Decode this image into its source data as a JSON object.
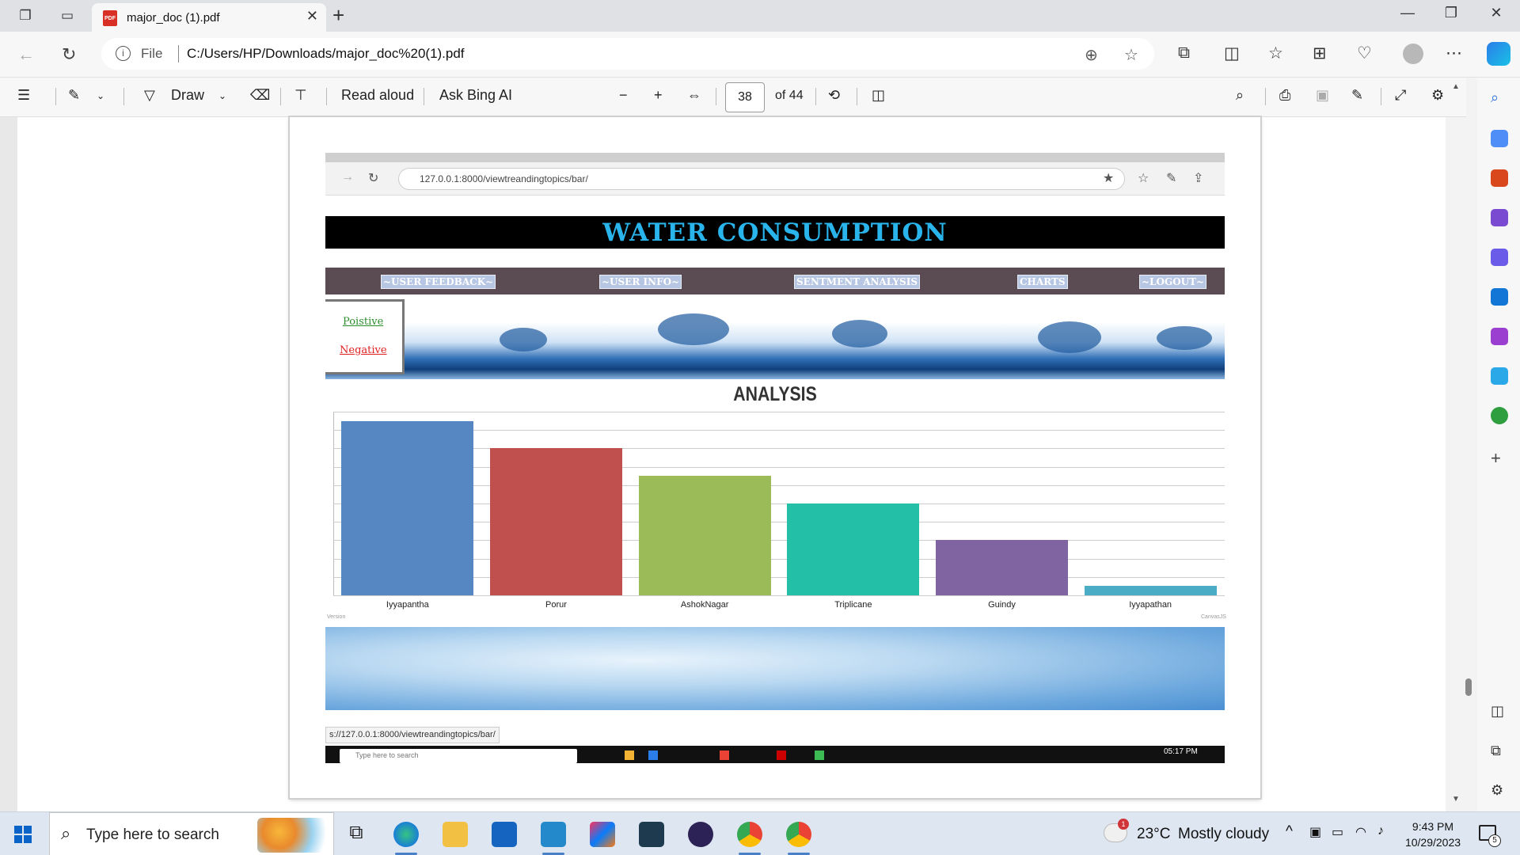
{
  "browser": {
    "tab_title": "major_doc (1).pdf",
    "tab_icon_text": "PDF",
    "file_label": "File",
    "url": "C:/Users/HP/Downloads/major_doc%20(1).pdf"
  },
  "pdf_toolbar": {
    "draw_label": "Draw",
    "read_aloud_label": "Read aloud",
    "ask_bing_label": "Ask Bing AI",
    "page_number": "38",
    "page_total": "of 44"
  },
  "embedded": {
    "url": "127.0.0.1:8000/viewtreandingtopics/bar/",
    "title": "WATER CONSUMPTION",
    "nav": [
      "~USER FEEDBACK~",
      "~USER INFO~",
      "SENTMENT ANALYSIS",
      "CHARTS",
      "~LOGOUT~"
    ],
    "legend_positive": "Poistive",
    "legend_negative": "Negative",
    "analysis_heading": "ANALYSIS",
    "footer_left": "Version",
    "footer_right": "CanvasJS",
    "status_url": "s://127.0.0.1:8000/viewtreandingtopics/bar/",
    "taskbar_search": "Type here to search",
    "taskbar_time": "05:17 PM"
  },
  "chart_data": {
    "type": "bar",
    "categories": [
      "Iyyapantha",
      "Porur",
      "AshokNagar",
      "Triplicane",
      "Guindy",
      "Iyyapathan"
    ],
    "values": [
      95,
      80,
      65,
      50,
      30,
      5
    ],
    "colors": [
      "#5687c2",
      "#c0504d",
      "#9bbb59",
      "#23c0a7",
      "#8064a2",
      "#4bacc6"
    ],
    "ylim": [
      0,
      100
    ],
    "grid": true
  },
  "taskbar": {
    "search_placeholder": "Type here to search",
    "weather_temp": "23°C",
    "weather_desc": "Mostly cloudy",
    "time": "9:43 PM",
    "date": "10/29/2023",
    "weather_badge": "1",
    "notification_count": "5"
  }
}
